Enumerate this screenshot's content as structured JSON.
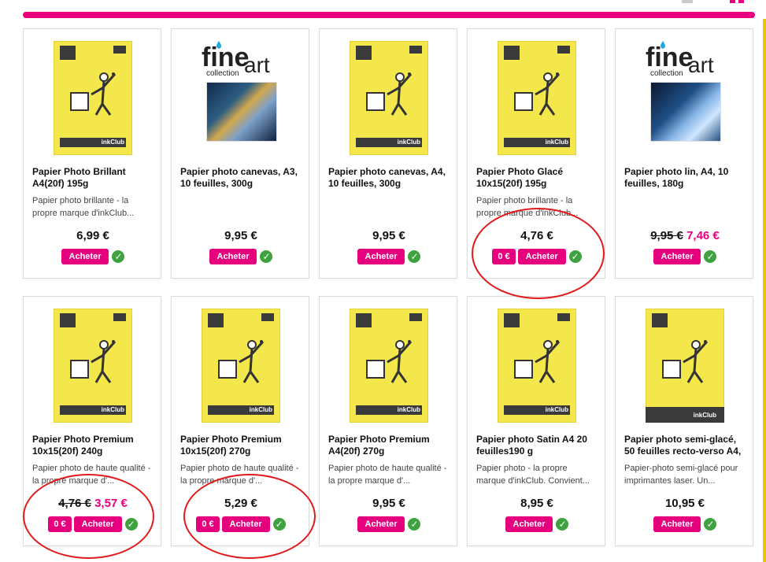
{
  "colors": {
    "accent": "#e8007f",
    "check": "#3ea23e",
    "circle": "#e01b1b",
    "yellow": "#f3e74c"
  },
  "cards": [
    {
      "title": "Papier Photo Brillant A4(20f) 195g",
      "desc": "Papier photo brillante - la propre marque d'inkClub...",
      "price": "6,99 €",
      "buy": "Acheter"
    },
    {
      "title": "Papier photo canevas, A3, 10 feuilles, 300g",
      "fine_word": "fine",
      "fine_art": "art",
      "fine_collection": "collection",
      "price": "9,95 €",
      "buy": "Acheter"
    },
    {
      "title": "Papier photo canevas, A4, 10 feuilles, 300g",
      "price": "9,95 €",
      "buy": "Acheter"
    },
    {
      "title": "Papier Photo Glacé 10x15(20f) 195g",
      "desc": "Papier photo brillante - la propre marque d'inkClub...",
      "price": "4,76 €",
      "zero": "0 €",
      "buy": "Acheter"
    },
    {
      "title": "Papier photo lin, A4, 10 feuilles, 180g",
      "fine_word": "fine",
      "fine_art": "art",
      "fine_collection": "collection",
      "price_old": "9,95 €",
      "price_new": "7,46 €",
      "buy": "Acheter"
    },
    {
      "title": "Papier Photo Premium 10x15(20f) 240g",
      "desc": "Papier photo de haute qualité - la propre marque d'...",
      "price_old": "4,76 €",
      "price_new": "3,57 €",
      "zero": "0 €",
      "buy": "Acheter"
    },
    {
      "title": "Papier Photo Premium 10x15(20f) 270g",
      "desc": "Papier photo de haute qualité - la propre marque d'...",
      "price": "5,29 €",
      "zero": "0 €",
      "buy": "Acheter"
    },
    {
      "title": "Papier Photo Premium A4(20f) 270g",
      "desc": "Papier photo de haute qualité - la propre marque d'...",
      "price": "9,95 €",
      "buy": "Acheter"
    },
    {
      "title": "Papier photo Satin A4 20 feuilles190 g",
      "desc": "Papier photo - la propre marque d'inkClub. Convient...",
      "price": "8,95 €",
      "buy": "Acheter"
    },
    {
      "title": "Papier photo semi-glacé, 50 feuilles recto-verso A4,",
      "desc": "Papier-photo semi-glacé pour imprimantes laser. Un...",
      "price": "10,95 €",
      "buy": "Acheter"
    }
  ],
  "brand": "inkClub",
  "icons": {
    "check": "check-icon"
  }
}
